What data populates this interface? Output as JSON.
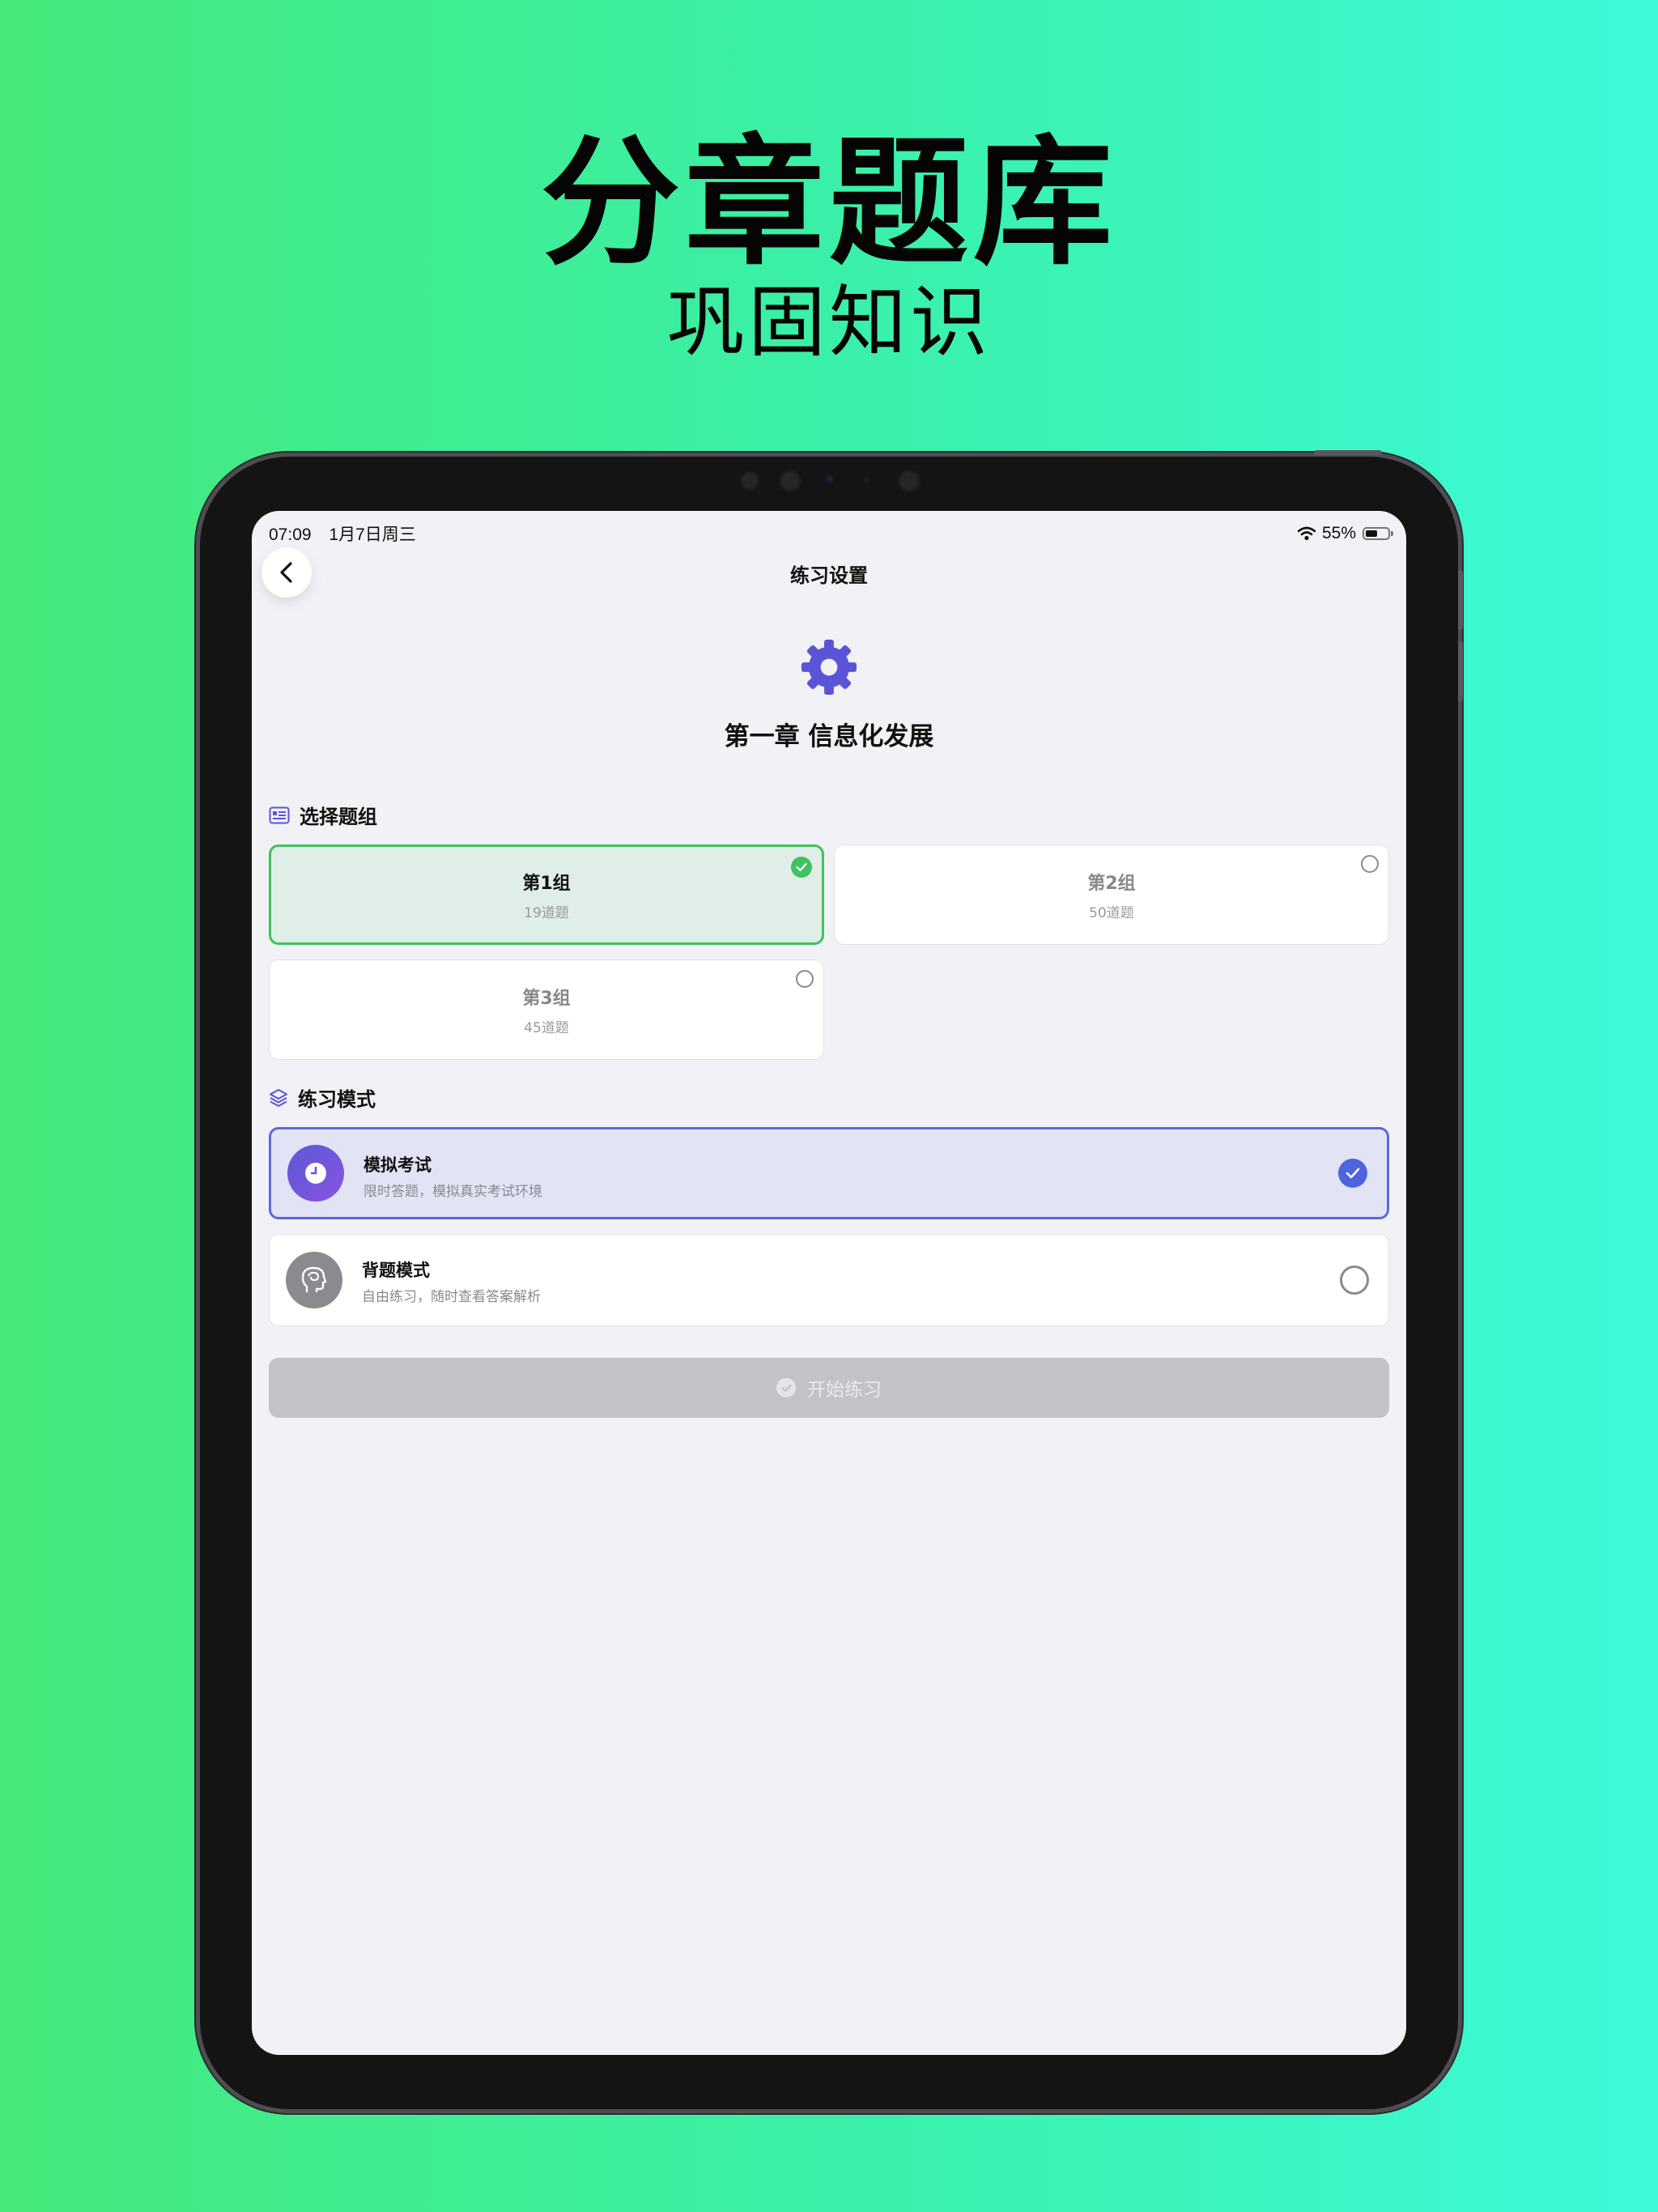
{
  "hero": {
    "title": "分章题库",
    "subtitle": "巩固知识"
  },
  "status_bar": {
    "time": "07:09",
    "date": "1月7日周三",
    "battery": "55%",
    "battery_level": 0.55
  },
  "nav": {
    "title": "练习设置",
    "back_icon": "chevron-left-icon"
  },
  "header": {
    "icon": "gear-icon",
    "chapter_title": "第一章 信息化发展",
    "accent": "#5b54d6"
  },
  "group_section": {
    "title": "选择题组",
    "icon": "list-icon",
    "groups": [
      {
        "name": "第1组",
        "count": "19道题",
        "selected": true
      },
      {
        "name": "第2组",
        "count": "50道题",
        "selected": false
      },
      {
        "name": "第3组",
        "count": "45道题",
        "selected": false
      }
    ]
  },
  "mode_section": {
    "title": "练习模式",
    "icon": "layers-icon",
    "modes": [
      {
        "title": "模拟考试",
        "description": "限时答题，模拟真实考试环境",
        "icon": "clock-icon",
        "selected": true
      },
      {
        "title": "背题模式",
        "description": "自由练习，随时查看答案解析",
        "icon": "brain-head-icon",
        "selected": false
      }
    ]
  },
  "start_button": {
    "label": "开始练习",
    "enabled": false
  },
  "colors": {
    "selected_group": "#3fc25f",
    "selected_mode": "#5b67e0",
    "screen_bg": "#f1f1f6"
  }
}
